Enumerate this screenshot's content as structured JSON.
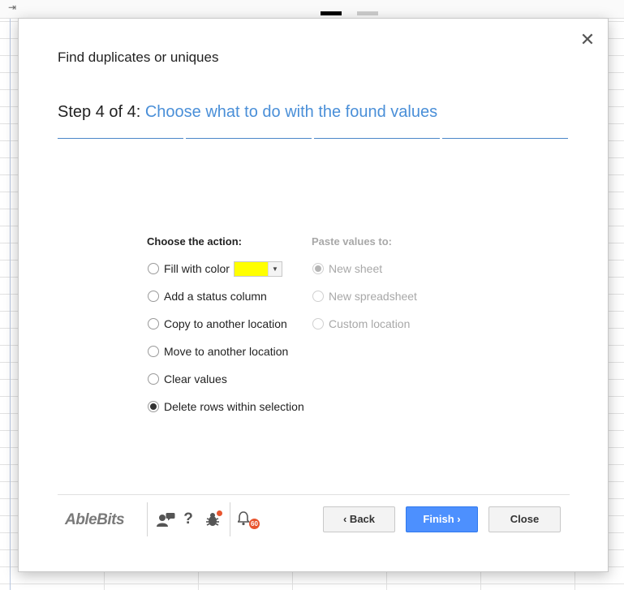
{
  "dialog": {
    "title": "Find duplicates or uniques",
    "close_glyph": "✕",
    "step": {
      "prefix": "Step 4 of 4: ",
      "description": "Choose what to do with the found values",
      "segments": 4
    }
  },
  "actions": {
    "header": "Choose the action:",
    "options": [
      {
        "label": "Fill with color",
        "checked": false
      },
      {
        "label": "Add a status column",
        "checked": false
      },
      {
        "label": "Copy to another location",
        "checked": false
      },
      {
        "label": "Move to another location",
        "checked": false
      },
      {
        "label": "Clear values",
        "checked": false
      },
      {
        "label": "Delete rows within selection",
        "checked": true
      }
    ],
    "fill_color": "#ffff00",
    "dropdown_caret": "▼"
  },
  "paste": {
    "header": "Paste values to:",
    "options": [
      {
        "label": "New sheet",
        "checked": true,
        "disabled": true
      },
      {
        "label": "New spreadsheet",
        "checked": false,
        "disabled": true
      },
      {
        "label": "Custom location",
        "checked": false,
        "disabled": true
      }
    ]
  },
  "footer": {
    "logo": "AbleBits",
    "help_label": "?",
    "notification_count": "60",
    "buttons": {
      "back": "‹ Back",
      "finish": "Finish ›",
      "close": "Close"
    }
  },
  "colors": {
    "accent": "#4a8fd8",
    "primary_button": "#4d90fe",
    "badge": "#e8552f"
  }
}
